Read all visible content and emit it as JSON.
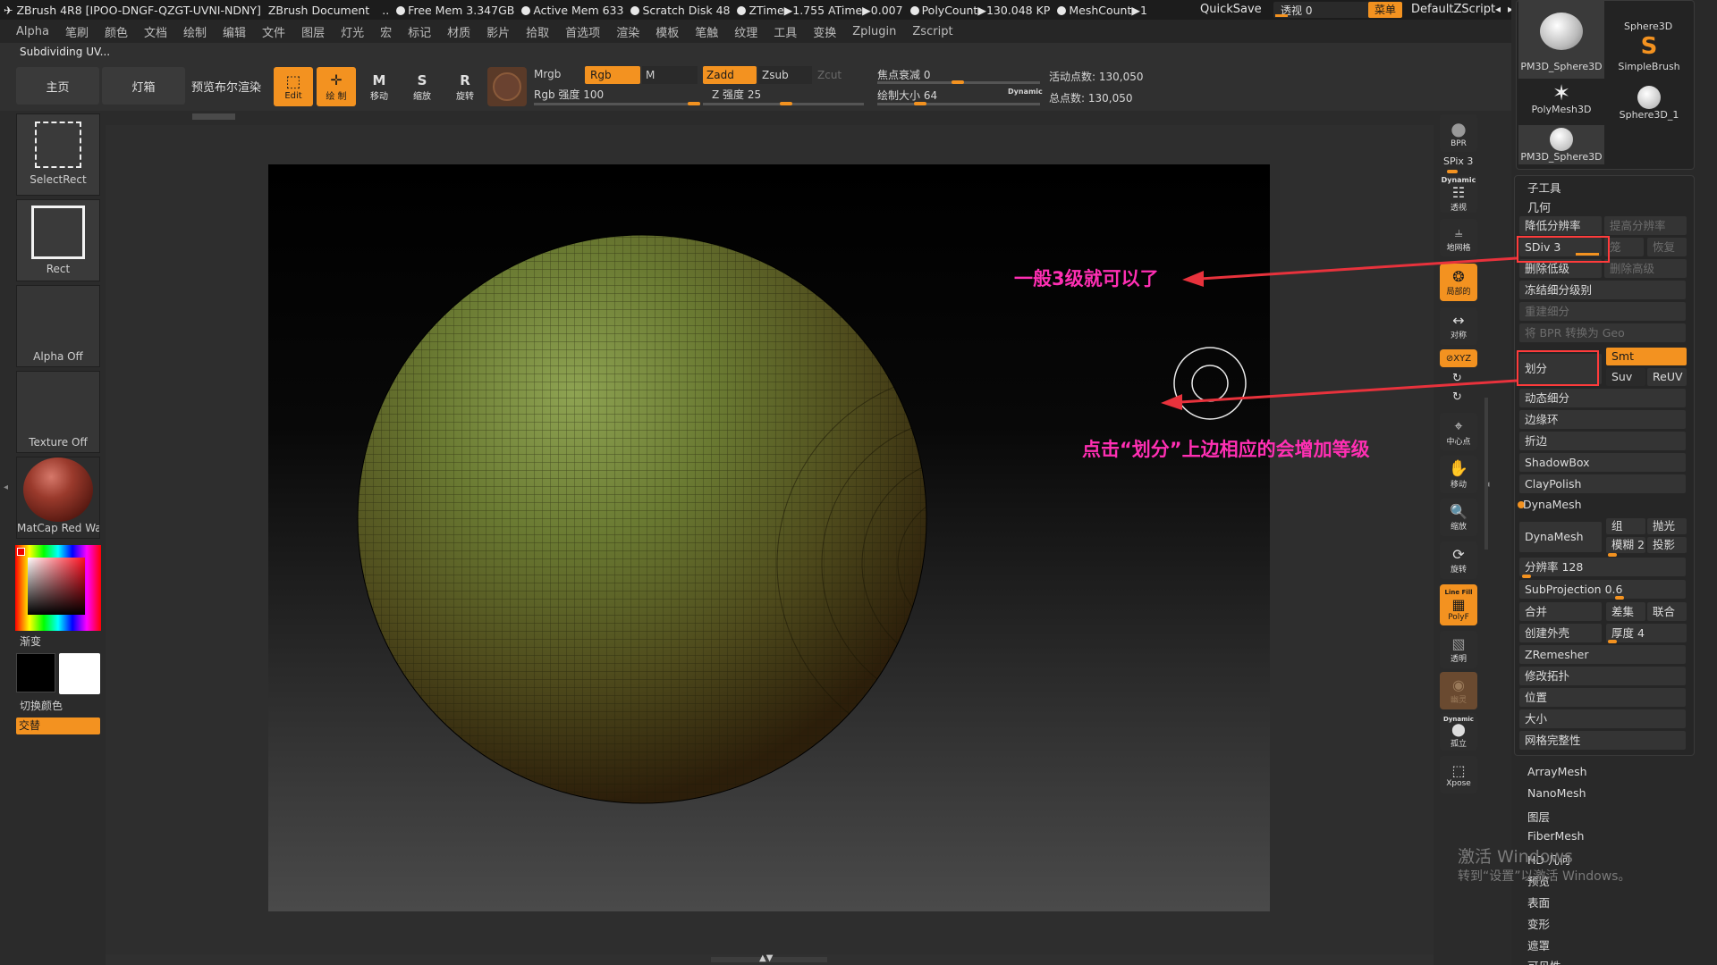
{
  "titlebar": {
    "app": "ZBrush 4R8 [IPOO-DNGF-QZGT-UVNI-NDNY]",
    "document": "ZBrush Document",
    "free_mem": "Free Mem 3.347GB",
    "active_mem": "Active Mem 633",
    "scratch": "Scratch Disk 48",
    "ztime": "ZTime▶1.755 ATime▶0.007",
    "polycount": "PolyCount▶130.048 KP",
    "meshcount": "MeshCount▶1",
    "quicksave": "QuickSave",
    "transparency": "透视  0",
    "menu_btn": "菜单",
    "script": "DefaultZScript"
  },
  "menubar": [
    "Alpha",
    "笔刷",
    "颜色",
    "文档",
    "绘制",
    "编辑",
    "文件",
    "图层",
    "灯光",
    "宏",
    "标记",
    "材质",
    "影片",
    "拾取",
    "首选项",
    "渲染",
    "模板",
    "笔触",
    "纹理",
    "工具",
    "变换",
    "Zplugin",
    "Zscript"
  ],
  "status": "Subdividing UV...",
  "toolbar": {
    "home": "主页",
    "lightbox": "灯箱",
    "preview": "预览布尔渲染",
    "edit": "Edit",
    "draw": "绘 制",
    "move": "移动",
    "scale": "缩放",
    "rotate": "旋转",
    "mrgb": "Mrgb",
    "rgb": "Rgb",
    "m": "M",
    "zadd": "Zadd",
    "zsub": "Zsub",
    "zcut": "Zcut",
    "rgb_intensity": "Rgb 强度 100",
    "z_intensity": "Z 强度 25",
    "focal": "焦点衰减 0",
    "draw_size": "绘制大小 64",
    "dynamic": "Dynamic",
    "active_points": "活动点数: 130,050",
    "total_points": "总点数: 130,050"
  },
  "left": {
    "select_rect": "SelectRect",
    "rect": "Rect",
    "alpha_off": "Alpha Off",
    "texture_off": "Texture Off",
    "matcap": "MatCap Red Wax",
    "gradient": "渐变",
    "switch_color": "切换颜色",
    "alternate": "交替"
  },
  "shelf": {
    "bpr": "BPR",
    "spix": "SPix 3",
    "dynamic": "Dynamic",
    "persp": "透视",
    "floor": "地网格",
    "local": "局部的",
    "sym": "对称",
    "xyz": "⊘XYZ",
    "center": "中心点",
    "move": "移动",
    "zoom": "缩放",
    "rotate": "旋转",
    "linefill": "Line Fill",
    "polyf": "PolyF",
    "transp": "透明",
    "ghost": "幽灵",
    "solo": "孤立",
    "xpose": "Xpose"
  },
  "tools": {
    "t1": "Sphere3D",
    "t2": "PM3D_Sphere3D",
    "t3": "SimpleBrush",
    "t4": "PolyMesh3D",
    "t5": "Sphere3D_1",
    "t6": "PM3D_Sphere3D"
  },
  "panel": {
    "subtool": "子工具",
    "geometry": "几何",
    "lower_res": "降低分辨率",
    "higher_res": "提高分辨率",
    "sdiv": "SDiv 3",
    "cage": "笼",
    "restore": "恢复",
    "del_lower": "删除低级",
    "del_higher": "删除高级",
    "freeze": "冻结细分级别",
    "reconstruct": "重建细分",
    "bpr_geo": "将 BPR 转换为 Geo",
    "divide": "划分",
    "smt": "Smt",
    "suv": "Suv",
    "reuv": "ReUV",
    "dyn_sub": "动态细分",
    "edge_loop": "边缘环",
    "crease": "折边",
    "shadowbox": "ShadowBox",
    "claypolish": "ClayPolish",
    "dynamesh_hdr": "DynaMesh",
    "dynamesh": "DynaMesh",
    "group": "组",
    "polish": "抛光",
    "blur": "模糊 2",
    "project": "投影",
    "resolution": "分辨率 128",
    "subprojection": "SubProjection 0.6",
    "add": "合并",
    "sub": "差集",
    "union": "联合",
    "create_shell": "创建外壳",
    "thickness": "厚度 4",
    "zremesher": "ZRemesher",
    "modify_topo": "修改拓扑",
    "position": "位置",
    "size": "大小",
    "mesh_integrity": "网格完整性",
    "arraymesh": "ArrayMesh",
    "nanomesh": "NanoMesh",
    "layers": "图层",
    "fibermesh": "FiberMesh",
    "geo_hd": "HD 几何",
    "preview": "预览",
    "surface": "表面",
    "deformation": "变形",
    "masking": "遮罩",
    "visibility": "可见性"
  },
  "annotations": {
    "a1": "一般3级就可以了",
    "a2": "点击“划分”上边相应的会增加等级"
  },
  "watermark": {
    "line1": "激活 Windows",
    "line2": "转到“设置”以激活 Windows。"
  },
  "colors": {
    "accent": "#f39220",
    "annotation": "#ff2fb3",
    "arrow": "#e8323c"
  }
}
